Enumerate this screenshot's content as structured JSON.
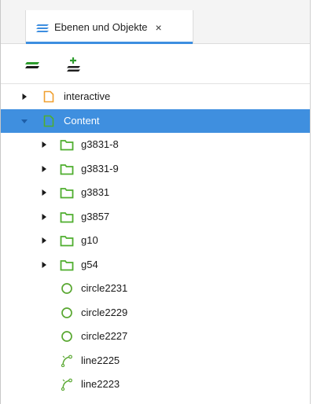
{
  "tab": {
    "label": "Ebenen und Objekte",
    "close": "×"
  },
  "toolbar": {
    "add_layer_icon": "add-layer-icon",
    "add_sublayer_icon": "add-sublayer-icon"
  },
  "colors": {
    "accent": "#3f8fdf",
    "layer_orange": "#f0a030",
    "group_green": "#4fae2e",
    "object_green": "#5aa832"
  },
  "tree": [
    {
      "label": "interactive",
      "type": "layer",
      "color": "orange",
      "expanded": false,
      "depth": 0,
      "selected": false
    },
    {
      "label": "Content",
      "type": "layer",
      "color": "green",
      "expanded": true,
      "depth": 0,
      "selected": true
    },
    {
      "label": "g3831-8",
      "type": "group",
      "expanded": false,
      "depth": 1,
      "selected": false
    },
    {
      "label": "g3831-9",
      "type": "group",
      "expanded": false,
      "depth": 1,
      "selected": false
    },
    {
      "label": "g3831",
      "type": "group",
      "expanded": false,
      "depth": 1,
      "selected": false
    },
    {
      "label": "g3857",
      "type": "group",
      "expanded": false,
      "depth": 1,
      "selected": false
    },
    {
      "label": "g10",
      "type": "group",
      "expanded": false,
      "depth": 1,
      "selected": false
    },
    {
      "label": "g54",
      "type": "group",
      "expanded": false,
      "depth": 1,
      "selected": false
    },
    {
      "label": "circle2231",
      "type": "circle",
      "depth": 1,
      "selected": false
    },
    {
      "label": "circle2229",
      "type": "circle",
      "depth": 1,
      "selected": false
    },
    {
      "label": "circle2227",
      "type": "circle",
      "depth": 1,
      "selected": false
    },
    {
      "label": "line2225",
      "type": "path",
      "depth": 1,
      "selected": false
    },
    {
      "label": "line2223",
      "type": "path",
      "depth": 1,
      "selected": false
    }
  ]
}
